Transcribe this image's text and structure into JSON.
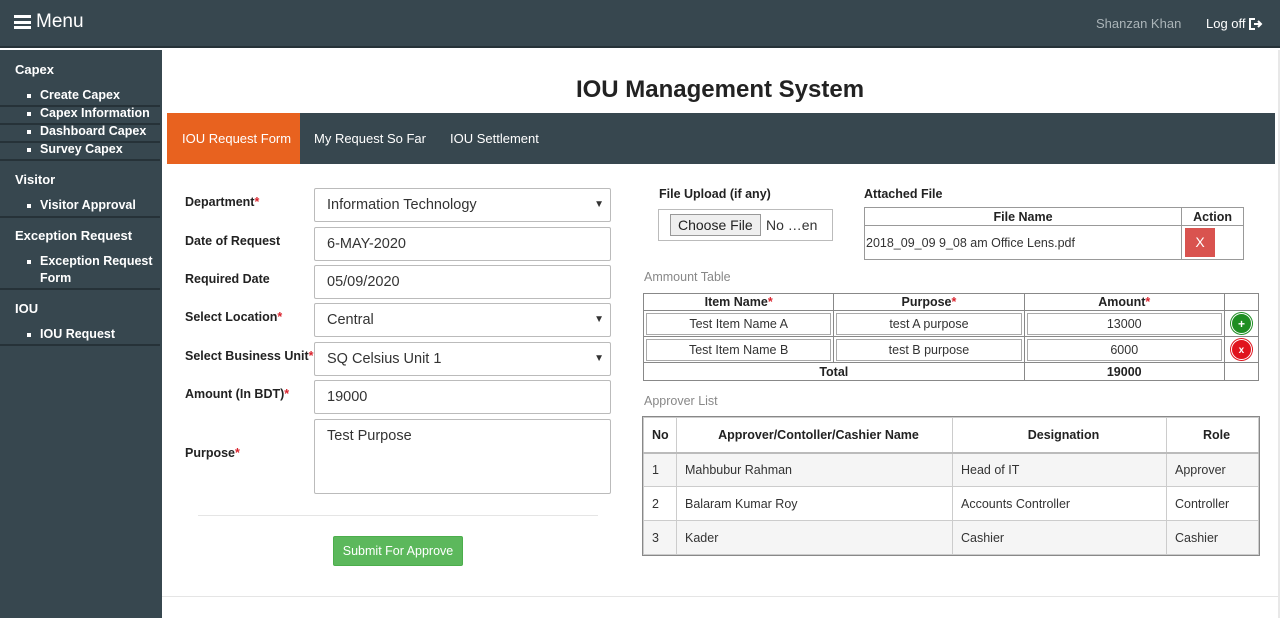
{
  "topbar": {
    "menu_label": "Menu",
    "user_name": "Shanzan Khan",
    "logoff_label": "Log off"
  },
  "sidebar": {
    "sections": [
      {
        "title": "Capex",
        "items": [
          "Create Capex",
          "Capex Information",
          "Dashboard Capex",
          "Survey Capex"
        ]
      },
      {
        "title": "Visitor",
        "items": [
          "Visitor Approval"
        ]
      },
      {
        "title": "Exception Request",
        "items": [
          "Exception Request Form"
        ]
      },
      {
        "title": "IOU",
        "items": [
          "IOU Request"
        ]
      }
    ]
  },
  "page": {
    "title": "IOU Management System"
  },
  "tabs": [
    {
      "label": "IOU Request Form",
      "active": true
    },
    {
      "label": "My Request So Far",
      "active": false
    },
    {
      "label": "IOU Settlement",
      "active": false
    }
  ],
  "form": {
    "department": {
      "label": "Department",
      "value": "Information Technology"
    },
    "date_of_request": {
      "label": "Date of Request",
      "value": "6-MAY-2020"
    },
    "required_date": {
      "label": "Required Date",
      "value": "05/09/2020"
    },
    "location": {
      "label": "Select Location",
      "value": "Central"
    },
    "business_unit": {
      "label": "Select Business Unit",
      "value": "SQ Celsius Unit 1"
    },
    "amount": {
      "label": "Amount (In BDT)",
      "value": "19000"
    },
    "purpose": {
      "label": "Purpose",
      "value": "Test Purpose"
    },
    "submit_label": "Submit For Approve"
  },
  "file_upload": {
    "label": "File Upload (if any)",
    "button_label": "Choose File",
    "status": "No …en"
  },
  "attached": {
    "label": "Attached File",
    "headers": [
      "File Name",
      "Action"
    ],
    "rows": [
      {
        "file_name": "2018_09_09 9_08 am Office Lens.pdf",
        "action": "X"
      }
    ]
  },
  "amount_table": {
    "caption": "Ammount Table",
    "headers": [
      "Item Name",
      "Purpose",
      "Amount"
    ],
    "rows": [
      {
        "item": "Test Item Name A",
        "purpose": "test A purpose",
        "amount": "13000",
        "button": "+"
      },
      {
        "item": "Test Item Name B",
        "purpose": "test B purpose",
        "amount": "6000",
        "button": "x"
      }
    ],
    "total_label": "Total",
    "total_value": "19000"
  },
  "approver": {
    "caption": "Approver List",
    "headers": [
      "No",
      "Approver/Contoller/Cashier Name",
      "Designation",
      "Role"
    ],
    "rows": [
      {
        "no": "1",
        "name": "Mahbubur Rahman",
        "designation": "Head of IT",
        "role": "Approver"
      },
      {
        "no": "2",
        "name": "Balaram Kumar Roy",
        "designation": "Accounts Controller",
        "role": "Controller"
      },
      {
        "no": "3",
        "name": "Kader",
        "designation": "Cashier",
        "role": "Cashier"
      }
    ]
  },
  "colors": {
    "navbar": "#37474f",
    "active_tab": "#e8621f",
    "submit": "#5cb85c",
    "delete": "#d9534f",
    "required": "#d9232d"
  }
}
